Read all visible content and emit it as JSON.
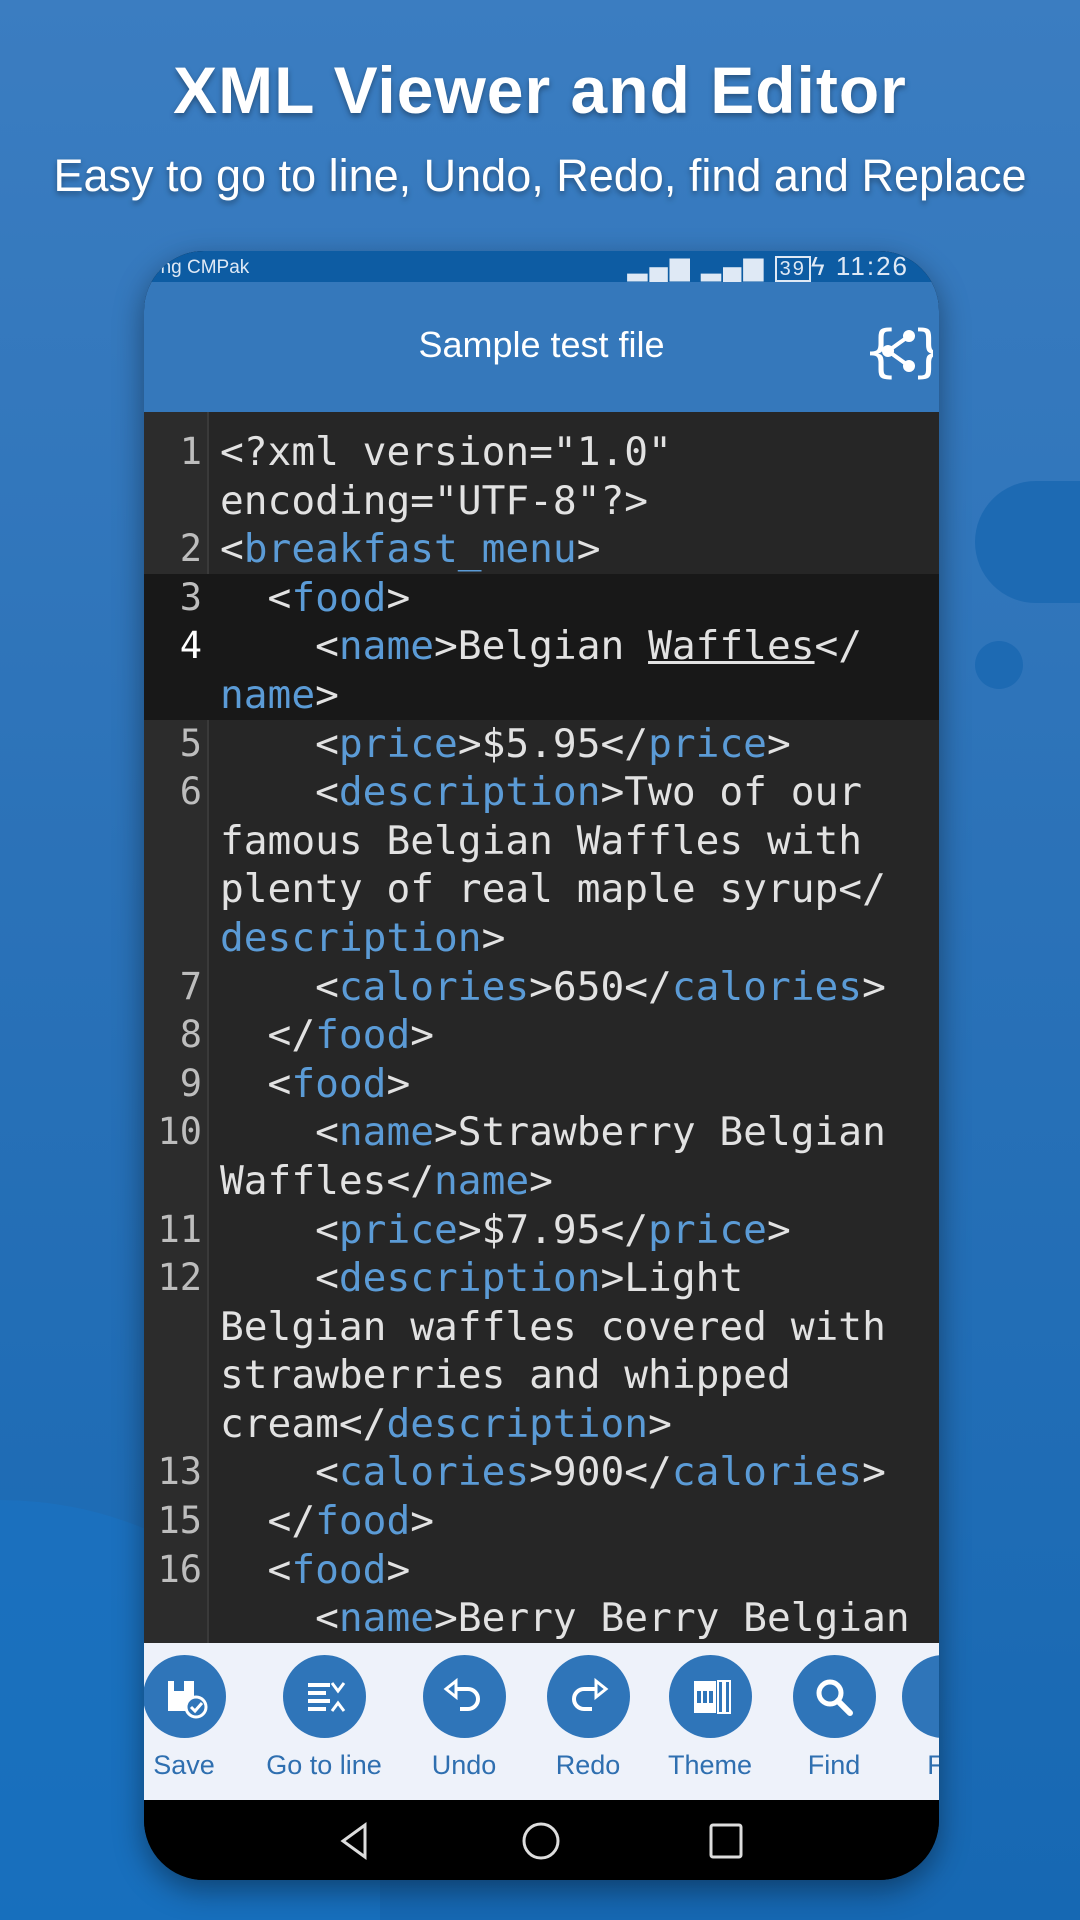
{
  "promo": {
    "title": "XML Viewer and Editor",
    "subtitle": "Easy to go to line, Undo, Redo, find and Replace"
  },
  "status_bar": {
    "carrier": "ong CMPak",
    "battery": "39",
    "time": "11:26"
  },
  "app_bar": {
    "title": "Sample test file",
    "share_icon": "xml-share-icon"
  },
  "colors": {
    "tag": "#5b9bd6",
    "text": "#e2e2e2",
    "editor_bg": "#262626",
    "accent": "#2f75b9",
    "app_bar": "#3578bb"
  },
  "editor": {
    "lines": [
      {
        "n": "1",
        "rows": [
          [
            [
              "t",
              "<?xml version=\"1.0\""
            ]
          ],
          [
            [
              "t",
              "encoding=\"UTF-8\"?>"
            ]
          ]
        ]
      },
      {
        "n": "2",
        "rows": [
          [
            [
              "t",
              "<"
            ],
            [
              "g",
              "breakfast_menu"
            ],
            [
              "t",
              ">"
            ]
          ]
        ]
      },
      {
        "n": "3",
        "highlighted": true,
        "rows": [
          [
            [
              "t",
              "  <"
            ],
            [
              "g",
              "food"
            ],
            [
              "t",
              ">"
            ]
          ]
        ]
      },
      {
        "n": "4",
        "highlighted": true,
        "current": true,
        "rows": [
          [
            [
              "t",
              "    <"
            ],
            [
              "g",
              "name"
            ],
            [
              "t",
              ">Belgian "
            ],
            [
              "u",
              "Waffles"
            ],
            [
              "t",
              "</"
            ]
          ],
          [
            [
              "g",
              "name"
            ],
            [
              "t",
              ">"
            ]
          ]
        ]
      },
      {
        "n": "5",
        "rows": [
          [
            [
              "t",
              "    <"
            ],
            [
              "g",
              "price"
            ],
            [
              "t",
              ">$5.95</"
            ],
            [
              "g",
              "price"
            ],
            [
              "t",
              ">"
            ]
          ]
        ]
      },
      {
        "n": "6",
        "rows": [
          [
            [
              "t",
              "    <"
            ],
            [
              "g",
              "description"
            ],
            [
              "t",
              ">Two of our"
            ]
          ],
          [
            [
              "t",
              "famous Belgian Waffles with"
            ]
          ],
          [
            [
              "t",
              "plenty of real maple syrup</"
            ]
          ],
          [
            [
              "g",
              "description"
            ],
            [
              "t",
              ">"
            ]
          ]
        ]
      },
      {
        "n": "7",
        "rows": [
          [
            [
              "t",
              "    <"
            ],
            [
              "g",
              "calories"
            ],
            [
              "t",
              ">650</"
            ],
            [
              "g",
              "calories"
            ],
            [
              "t",
              ">"
            ]
          ]
        ]
      },
      {
        "n": "8",
        "rows": [
          [
            [
              "t",
              "  </"
            ],
            [
              "g",
              "food"
            ],
            [
              "t",
              ">"
            ]
          ]
        ]
      },
      {
        "n": "9",
        "rows": [
          [
            [
              "t",
              "  <"
            ],
            [
              "g",
              "food"
            ],
            [
              "t",
              ">"
            ]
          ]
        ]
      },
      {
        "n": "10",
        "rows": [
          [
            [
              "t",
              "    <"
            ],
            [
              "g",
              "name"
            ],
            [
              "t",
              ">Strawberry Belgian"
            ]
          ],
          [
            [
              "t",
              "Waffles</"
            ],
            [
              "g",
              "name"
            ],
            [
              "t",
              ">"
            ]
          ]
        ]
      },
      {
        "n": "11",
        "rows": [
          [
            [
              "t",
              "    <"
            ],
            [
              "g",
              "price"
            ],
            [
              "t",
              ">$7.95</"
            ],
            [
              "g",
              "price"
            ],
            [
              "t",
              ">"
            ]
          ]
        ]
      },
      {
        "n": "12",
        "rows": [
          [
            [
              "t",
              "    <"
            ],
            [
              "g",
              "description"
            ],
            [
              "t",
              ">Light"
            ]
          ],
          [
            [
              "t",
              "Belgian waffles covered with"
            ]
          ],
          [
            [
              "t",
              "strawberries and whipped"
            ]
          ],
          [
            [
              "t",
              "cream</"
            ],
            [
              "g",
              "description"
            ],
            [
              "t",
              ">"
            ]
          ]
        ]
      },
      {
        "n": "13",
        "rows": [
          [
            [
              "t",
              "    <"
            ],
            [
              "g",
              "calories"
            ],
            [
              "t",
              ">900</"
            ],
            [
              "g",
              "calories"
            ],
            [
              "t",
              ">"
            ]
          ]
        ]
      },
      {
        "n": "15",
        "rows": [
          [
            [
              "t",
              "  </"
            ],
            [
              "g",
              "food"
            ],
            [
              "t",
              ">"
            ]
          ]
        ]
      },
      {
        "n": "16",
        "rows": [
          [
            [
              "t",
              "  <"
            ],
            [
              "g",
              "food"
            ],
            [
              "t",
              ">"
            ]
          ]
        ]
      },
      {
        "n": "",
        "rows": [
          [
            [
              "t",
              "    <"
            ],
            [
              "g",
              "name"
            ],
            [
              "t",
              ">Berry Berry Belgian"
            ]
          ]
        ]
      }
    ]
  },
  "toolbar": {
    "items": [
      {
        "label": "Save",
        "icon": "save-icon"
      },
      {
        "label": "Go to line",
        "icon": "go-to-line-icon"
      },
      {
        "label": "Undo",
        "icon": "undo-icon"
      },
      {
        "label": "Redo",
        "icon": "redo-icon"
      },
      {
        "label": "Theme",
        "icon": "theme-icon"
      },
      {
        "label": "Find",
        "icon": "search-icon"
      },
      {
        "label": "Fo",
        "icon": "format-icon"
      }
    ]
  }
}
